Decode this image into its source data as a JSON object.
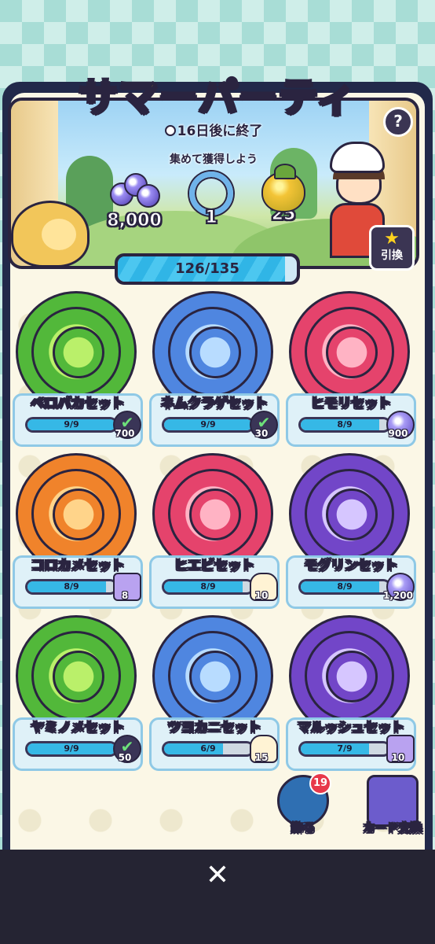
{
  "event": {
    "title": "サマーパーティ",
    "timer": "16日後に終了",
    "subtitle": "集めて獲得しよう",
    "rewards": [
      {
        "icon": "gem-icon",
        "value": "8,000"
      },
      {
        "icon": "float-ring-icon",
        "value": "1"
      },
      {
        "icon": "fruit-icon",
        "value": "25"
      }
    ],
    "help_label": "?",
    "exchange_label": "引換",
    "progress": {
      "text": "126/135",
      "current": 126,
      "total": 135
    }
  },
  "sets": [
    {
      "name": "ペロパカセット",
      "progress": "9/9",
      "current": 9,
      "total": 9,
      "reward_type": "done",
      "reward": "700",
      "color": "green"
    },
    {
      "name": "ネムクラゲセット",
      "progress": "9/9",
      "current": 9,
      "total": 9,
      "reward_type": "done",
      "reward": "30",
      "color": "blue"
    },
    {
      "name": "ヒモリセット",
      "progress": "8/9",
      "current": 8,
      "total": 9,
      "reward_type": "gems",
      "reward": "900",
      "color": "pink"
    },
    {
      "name": "コロカメセット",
      "progress": "8/9",
      "current": 8,
      "total": 9,
      "reward_type": "box",
      "reward": "8",
      "color": "orange"
    },
    {
      "name": "ヒエビセット",
      "progress": "8/9",
      "current": 8,
      "total": 9,
      "reward_type": "cake",
      "reward": "10",
      "color": "pink"
    },
    {
      "name": "モグリンセット",
      "progress": "8/9",
      "current": 8,
      "total": 9,
      "reward_type": "gems",
      "reward": "1,200",
      "color": "purple"
    },
    {
      "name": "ヤミノメセット",
      "progress": "9/9",
      "current": 9,
      "total": 9,
      "reward_type": "done",
      "reward": "50",
      "color": "green"
    },
    {
      "name": "ツヨカニセット",
      "progress": "6/9",
      "current": 6,
      "total": 9,
      "reward_type": "cake",
      "reward": "15",
      "color": "blue"
    },
    {
      "name": "マルッシュセット",
      "progress": "7/9",
      "current": 7,
      "total": 9,
      "reward_type": "box",
      "reward": "10",
      "color": "purple"
    }
  ],
  "actions": {
    "decorate": {
      "label": "飾る",
      "badge": "19"
    },
    "card_exchange": {
      "label": "カード交換"
    }
  },
  "close_label": "✕"
}
